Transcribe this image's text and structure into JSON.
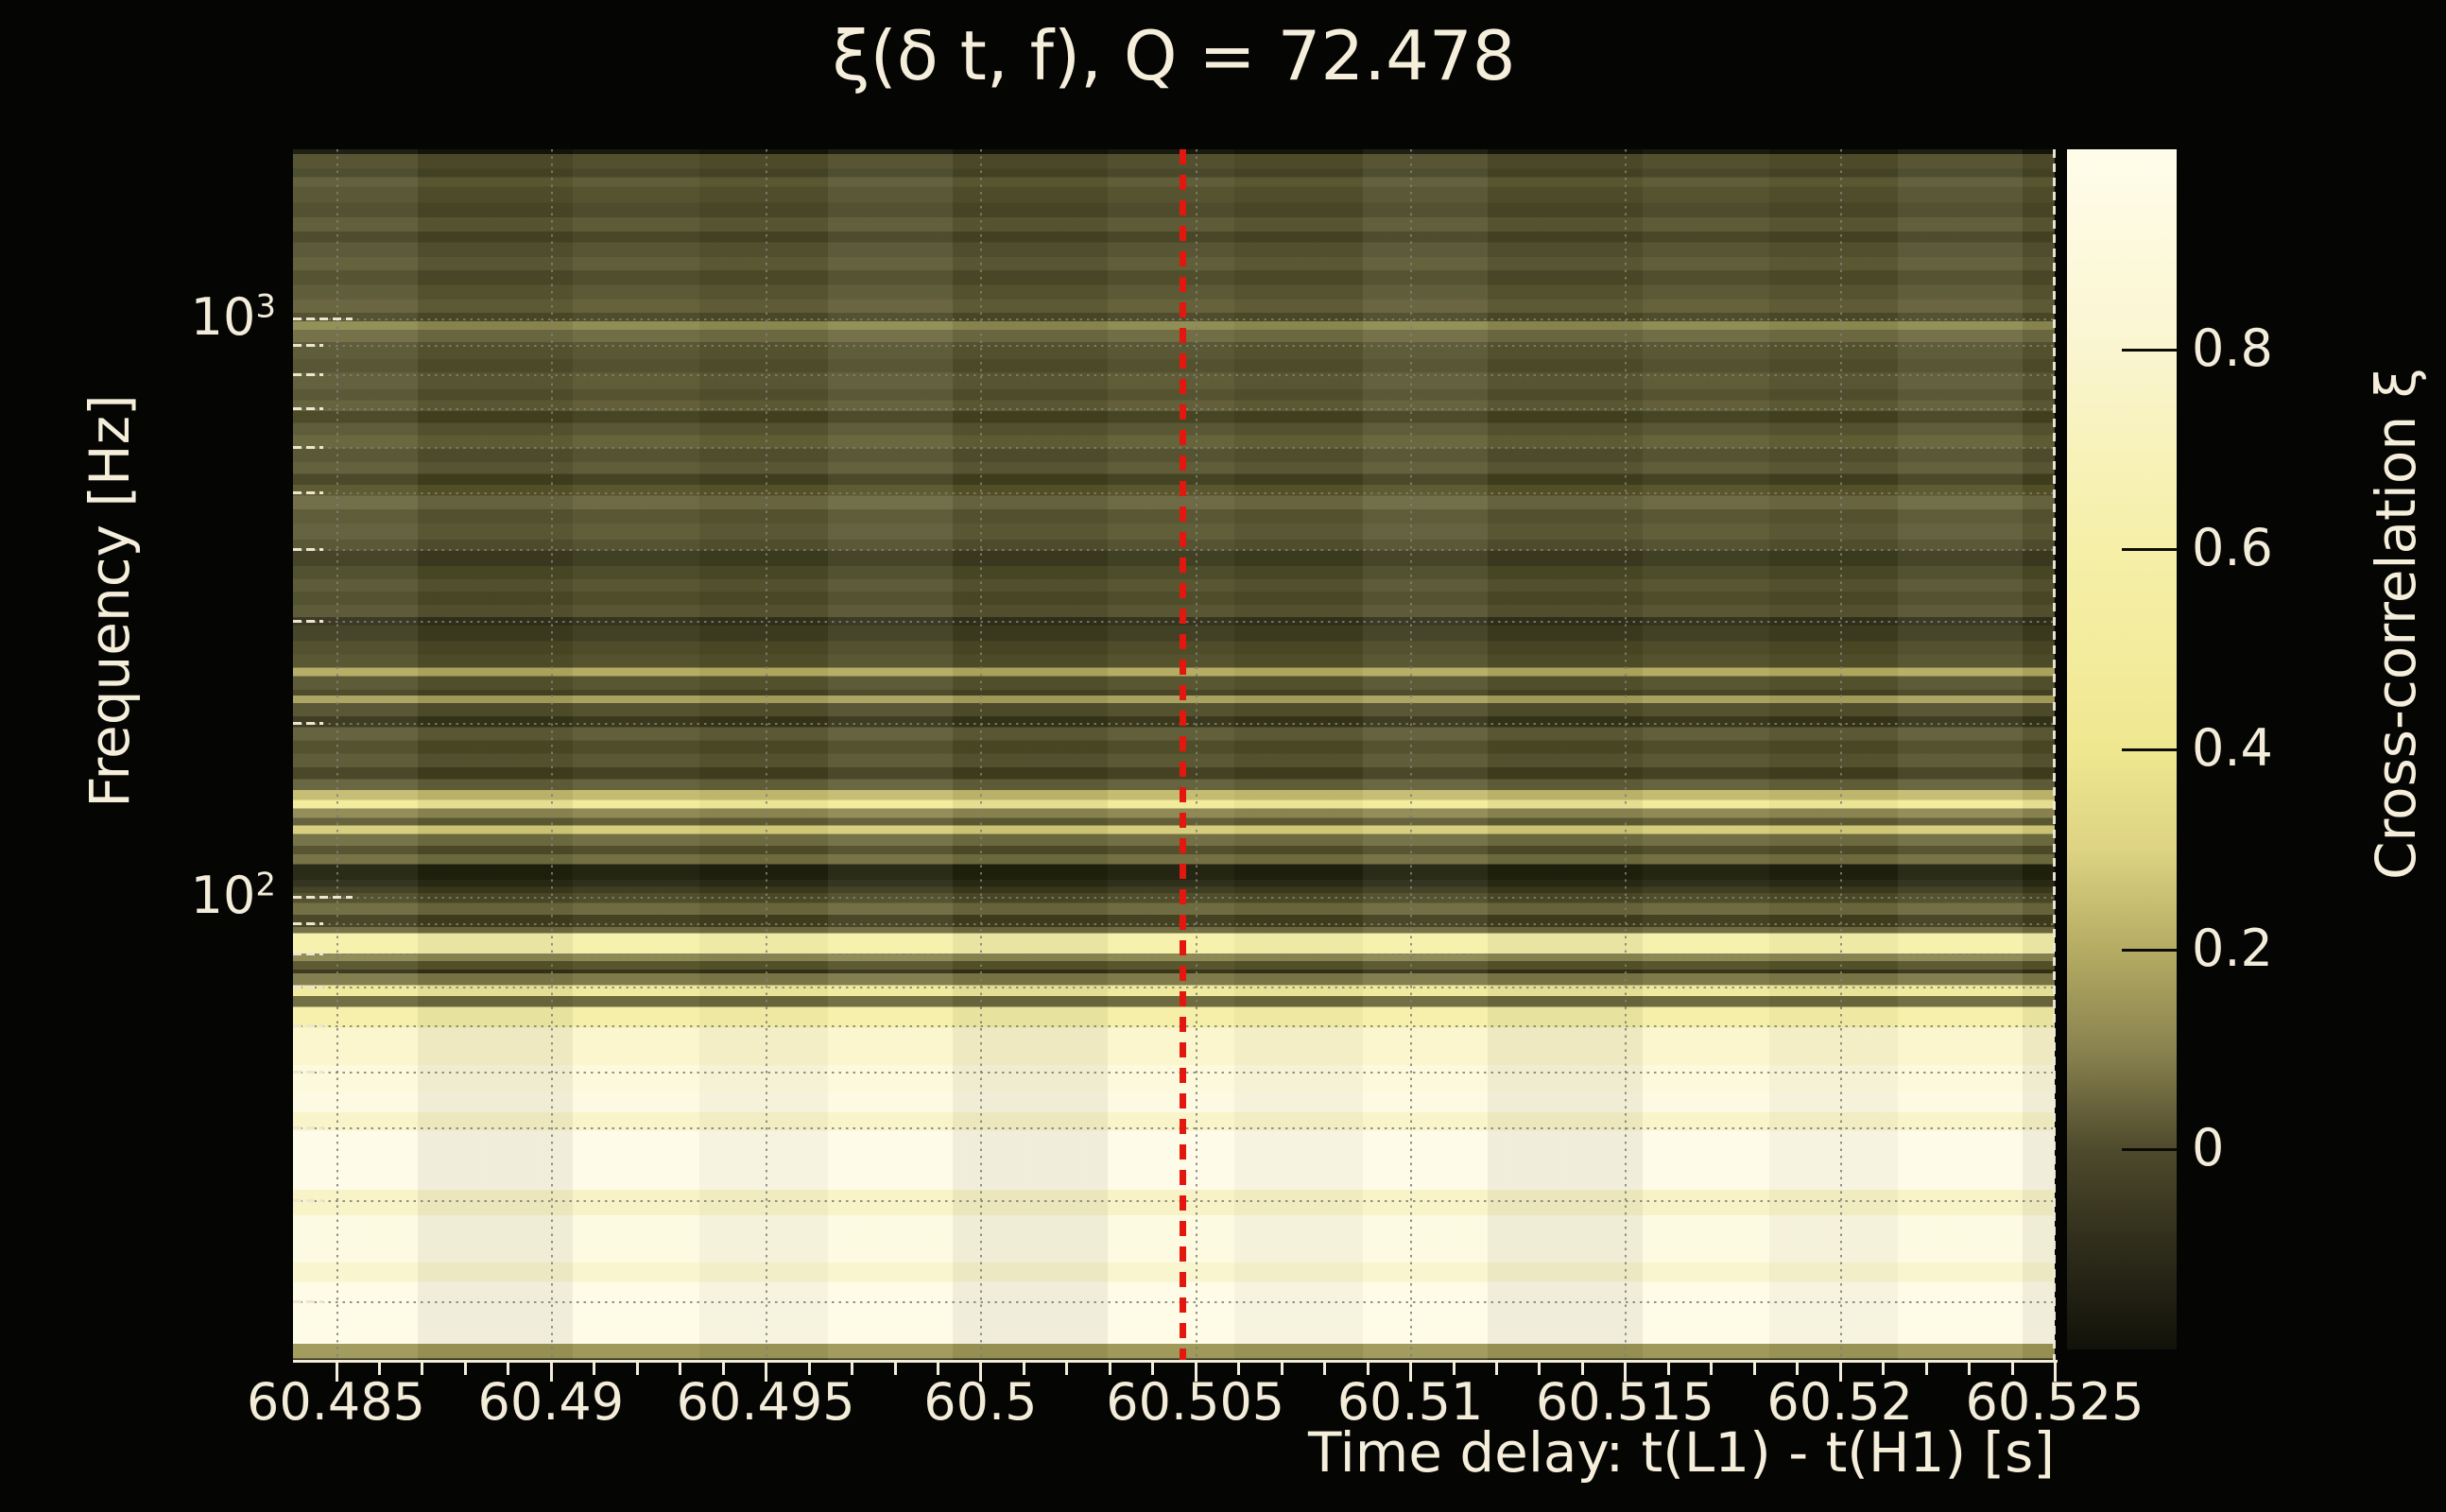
{
  "figure": {
    "title": "ξ(δ t, f), Q = 72.478",
    "background": "#050504",
    "text_color": "#f2ecd9"
  },
  "chart_data": {
    "type": "heatmap",
    "title": "ξ(δ t, f), Q = 72.478",
    "q_value": 72.478,
    "xlabel": "Time delay: t(L1) - t(H1) [s]",
    "ylabel": "Frequency [Hz]",
    "grid": true,
    "x_axis": {
      "min": 60.484,
      "max": 60.525,
      "major_ticks": [
        {
          "v": 60.485,
          "label": "60.485"
        },
        {
          "v": 60.49,
          "label": "60.49"
        },
        {
          "v": 60.495,
          "label": "60.495"
        },
        {
          "v": 60.5,
          "label": "60.5"
        },
        {
          "v": 60.505,
          "label": "60.505"
        },
        {
          "v": 60.51,
          "label": "60.51"
        },
        {
          "v": 60.515,
          "label": "60.515"
        },
        {
          "v": 60.52,
          "label": "60.52"
        },
        {
          "v": 60.525,
          "label": "60.525"
        }
      ],
      "minor_step": 0.001
    },
    "y_axis": {
      "scale": "log",
      "min": 15.8,
      "max": 1960,
      "major_ticks": [
        {
          "v": 1000,
          "base": "10",
          "exp": "3"
        },
        {
          "v": 100,
          "base": "10",
          "exp": "2"
        }
      ],
      "minor_ticks": [
        900,
        800,
        700,
        600,
        500,
        400,
        300,
        200,
        90,
        80,
        70,
        60,
        50,
        40,
        30,
        20
      ]
    },
    "colorbar": {
      "label": "Cross-correlation ξ",
      "min": -0.2,
      "max": 1.0,
      "ticks": [
        {
          "v": 0.8,
          "label": "0.8"
        },
        {
          "v": 0.6,
          "label": "0.6"
        },
        {
          "v": 0.4,
          "label": "0.4"
        },
        {
          "v": 0.2,
          "label": "0.2"
        },
        {
          "v": 0.0,
          "label": "0"
        }
      ],
      "gradient": [
        {
          "v": -0.2,
          "c": "#12120a"
        },
        {
          "v": -0.1,
          "c": "#2e2c1a"
        },
        {
          "v": 0.0,
          "c": "#4e4a2c"
        },
        {
          "v": 0.1,
          "c": "#8a8350"
        },
        {
          "v": 0.2,
          "c": "#b5ac63"
        },
        {
          "v": 0.3,
          "c": "#ddd383"
        },
        {
          "v": 0.4,
          "c": "#efe790"
        },
        {
          "v": 0.5,
          "c": "#f3ec9d"
        },
        {
          "v": 0.6,
          "c": "#f5efa8"
        },
        {
          "v": 0.7,
          "c": "#f8f2bb"
        },
        {
          "v": 0.8,
          "c": "#faf5d0"
        },
        {
          "v": 0.9,
          "c": "#fdf9dd"
        },
        {
          "v": 1.0,
          "c": "#fffcea"
        }
      ]
    },
    "marker_line": {
      "x": 60.5047,
      "color": "#e2180e",
      "style": "dashed"
    },
    "heat_stripes": [
      [
        0.4,
        "#141409"
      ],
      [
        1.6,
        "#4e4c2a"
      ],
      [
        2.3,
        "#454426"
      ],
      [
        3.1,
        "#5c5a34"
      ],
      [
        4.4,
        "#514f2c"
      ],
      [
        5.6,
        "#4a4827"
      ],
      [
        6.8,
        "#5a5733"
      ],
      [
        7.7,
        "#454323"
      ],
      [
        8.9,
        "#535130"
      ],
      [
        10.0,
        "#5d5b35"
      ],
      [
        11.2,
        "#4c4a28"
      ],
      [
        12.4,
        "#585631"
      ],
      [
        13.5,
        "#615e38"
      ],
      [
        14.2,
        "#4b4926"
      ],
      [
        14.9,
        "#8d8a52"
      ],
      [
        15.9,
        "#6e6b41"
      ],
      [
        17.3,
        "#565430"
      ],
      [
        18.4,
        "#4f4d2a"
      ],
      [
        19.8,
        "#5b5934"
      ],
      [
        20.7,
        "#514f2c"
      ],
      [
        21.6,
        "#5e5b36"
      ],
      [
        22.6,
        "#43421f"
      ],
      [
        23.6,
        "#565430"
      ],
      [
        24.7,
        "#626036"
      ],
      [
        25.8,
        "#514f2d"
      ],
      [
        26.8,
        "#5b5935"
      ],
      [
        27.7,
        "#403f1f"
      ],
      [
        28.6,
        "#565329"
      ],
      [
        29.7,
        "#6a6741"
      ],
      [
        30.9,
        "#565430"
      ],
      [
        32.2,
        "#5d5b36"
      ],
      [
        33.1,
        "#524f2e"
      ],
      [
        34.4,
        "#3c3b20"
      ],
      [
        35.5,
        "#4a4926"
      ],
      [
        36.5,
        "#55532e"
      ],
      [
        37.6,
        "#4b4a26"
      ],
      [
        38.6,
        "#555230"
      ],
      [
        39.3,
        "#31301a"
      ],
      [
        40.6,
        "#3d3c20"
      ],
      [
        41.7,
        "#4a4824"
      ],
      [
        42.8,
        "#514e2a"
      ],
      [
        43.5,
        "#b3ab60"
      ],
      [
        44.6,
        "#55522e"
      ],
      [
        45.1,
        "#454322"
      ],
      [
        45.7,
        "#a8a05c"
      ],
      [
        46.8,
        "#514e2c"
      ],
      [
        47.7,
        "#353419"
      ],
      [
        48.8,
        "#5e5b37"
      ],
      [
        49.9,
        "#4b4a25"
      ],
      [
        51.0,
        "#575430"
      ],
      [
        52.0,
        "#403e1e"
      ],
      [
        52.9,
        "#62603a"
      ],
      [
        53.7,
        "#c3bb6e"
      ],
      [
        54.4,
        "#f2eb9a"
      ],
      [
        55.2,
        "#8d8852"
      ],
      [
        55.8,
        "#5e5b35"
      ],
      [
        56.5,
        "#d6cd7a"
      ],
      [
        57.5,
        "#716d41"
      ],
      [
        58.2,
        "#4e4c28"
      ],
      [
        59.0,
        "#716d3f"
      ],
      [
        60.3,
        "#20200f"
      ],
      [
        60.9,
        "#2b2a16"
      ],
      [
        61.4,
        "#3b3a1e"
      ],
      [
        62.2,
        "#4c4a26"
      ],
      [
        63.2,
        "#6c683d"
      ],
      [
        64.2,
        "#403e1e"
      ],
      [
        64.7,
        "#6e6a40"
      ],
      [
        66.4,
        "#f6f1ab"
      ],
      [
        67.0,
        "#8c8750"
      ],
      [
        67.7,
        "#55522a"
      ],
      [
        68.0,
        "#333117"
      ],
      [
        69.0,
        "#7c7847"
      ],
      [
        69.9,
        "#f0ea9c"
      ],
      [
        70.8,
        "#6b673c"
      ],
      [
        72.5,
        "#f5efa8"
      ],
      [
        75.6,
        "#fbf6cc"
      ],
      [
        77.9,
        "#fdf9dc"
      ],
      [
        79.5,
        "#fdfae3"
      ],
      [
        81.0,
        "#f9f4c8"
      ],
      [
        85.9,
        "#fefbe8"
      ],
      [
        88.0,
        "#f8f3c6"
      ],
      [
        91.9,
        "#fdfae2"
      ],
      [
        93.5,
        "#f9f5cd"
      ],
      [
        98.6,
        "#fefbe6"
      ],
      [
        99.8,
        "#9d9757"
      ],
      [
        100,
        "#23220f"
      ]
    ]
  }
}
